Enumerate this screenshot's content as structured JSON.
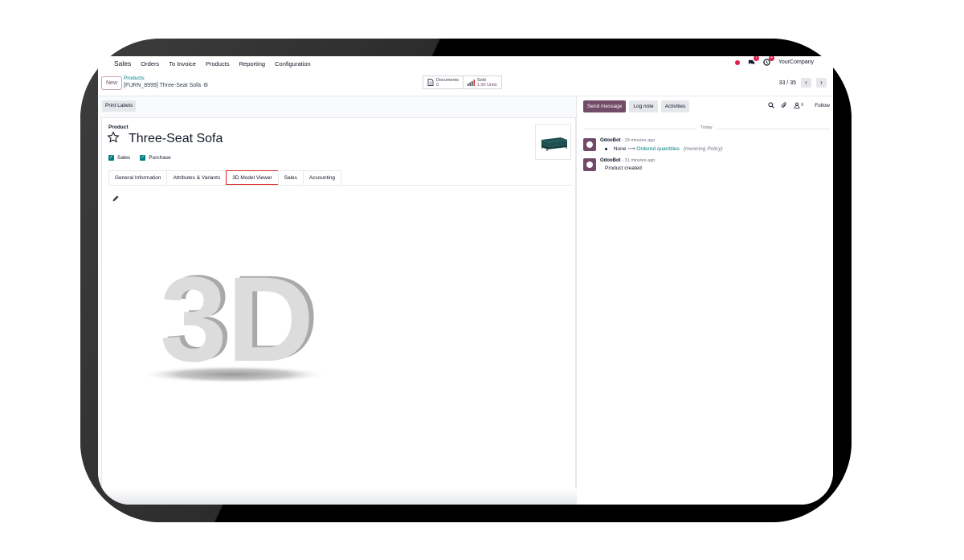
{
  "topnav": {
    "app": "Sales",
    "items": [
      "Orders",
      "To Invoice",
      "Products",
      "Reporting",
      "Configuration"
    ],
    "company": "YourCompany",
    "messages_badge": "7",
    "activities_badge": "4"
  },
  "control": {
    "new_label": "New",
    "breadcrumb_parent": "Products",
    "breadcrumb_record": "[FURN_8999] Three-Seat Sofa",
    "documents_label": "Documents",
    "documents_value": "0",
    "sold_label": "Sold",
    "sold_value": "1.00 Units",
    "pager": "33 / 35"
  },
  "form": {
    "print_labels": "Print Labels",
    "product_label": "Product",
    "name": "Three-Seat Sofa",
    "sales_label": "Sales",
    "purchase_label": "Purchase",
    "tabs": [
      "General Information",
      "Attributes & Variants",
      "3D Model Viewer",
      "Sales",
      "Accounting"
    ],
    "active_tab": "3D Model Viewer",
    "model_text": "3D"
  },
  "chatter": {
    "send_message": "Send message",
    "log_note": "Log note",
    "activities": "Activities",
    "followers_count": "0",
    "follow": "Follow",
    "today": "Today",
    "messages": [
      {
        "author": "OdooBot",
        "time": "- 29 minutes ago",
        "old_value": "None",
        "new_value": "Ordered quantities",
        "field": "(Invoicing Policy)"
      },
      {
        "author": "OdooBot",
        "time": "- 31 minutes ago",
        "body": "Product created"
      }
    ]
  },
  "colors": {
    "brand": "#714b67",
    "link": "#017e84",
    "badge": "#e11d48",
    "highlight": "#e02424"
  }
}
